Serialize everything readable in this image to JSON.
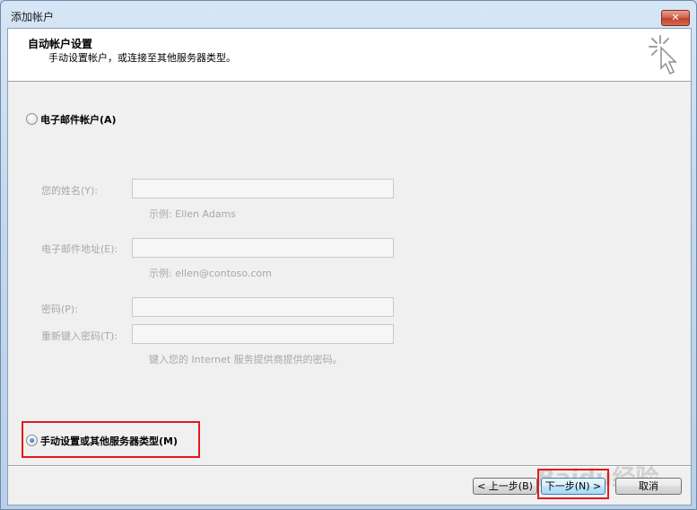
{
  "window": {
    "title": "添加帐户",
    "close_label": "✕"
  },
  "header": {
    "title": "自动帐户设置",
    "subtitle": "手动设置帐户，或连接至其他服务器类型。"
  },
  "options": {
    "email_account_label": "电子邮件帐户(A)",
    "manual_label": "手动设置或其他服务器类型(M)",
    "selected": "manual"
  },
  "form": {
    "name_label": "您的姓名(Y):",
    "name_value": "",
    "name_hint": "示例: Ellen Adams",
    "email_label": "电子邮件地址(E):",
    "email_value": "",
    "email_hint": "示例: ellen@contoso.com",
    "password_label": "密码(P):",
    "password_value": "",
    "retype_label": "重新键入密码(T):",
    "retype_value": "",
    "password_hint": "键入您的 Internet 服务提供商提供的密码。"
  },
  "buttons": {
    "back": "< 上一步(B)",
    "next": "下一步(N) >",
    "cancel": "取消"
  },
  "watermark": "Baidu经验",
  "colors": {
    "highlight": "#e21a1a",
    "radio_selected": "#1f5ea8"
  }
}
